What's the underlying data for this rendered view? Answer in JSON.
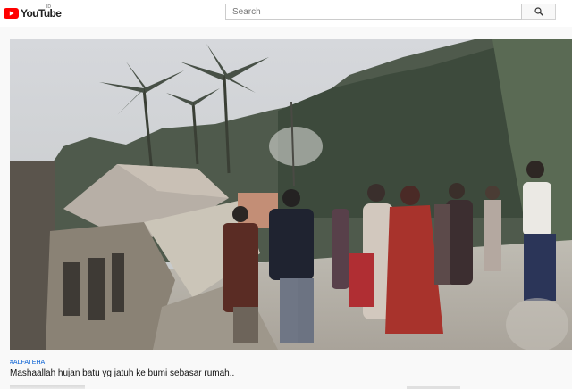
{
  "masthead": {
    "logo_text": "YouTube",
    "region_code": "ID",
    "logo_icon": "youtube-play-icon",
    "brand_color": "#ff0000"
  },
  "search": {
    "placeholder": "Search",
    "value": "",
    "button_icon": "search-icon"
  },
  "video": {
    "hashtag": "#ALFATEHA",
    "title": "Mashaallah hujan batu yg jatuh ke bumi sebasar rumah.."
  },
  "colors": {
    "link": "#065fd4",
    "title_text": "#0f0f0f",
    "page_background": "#f9f9f9"
  }
}
